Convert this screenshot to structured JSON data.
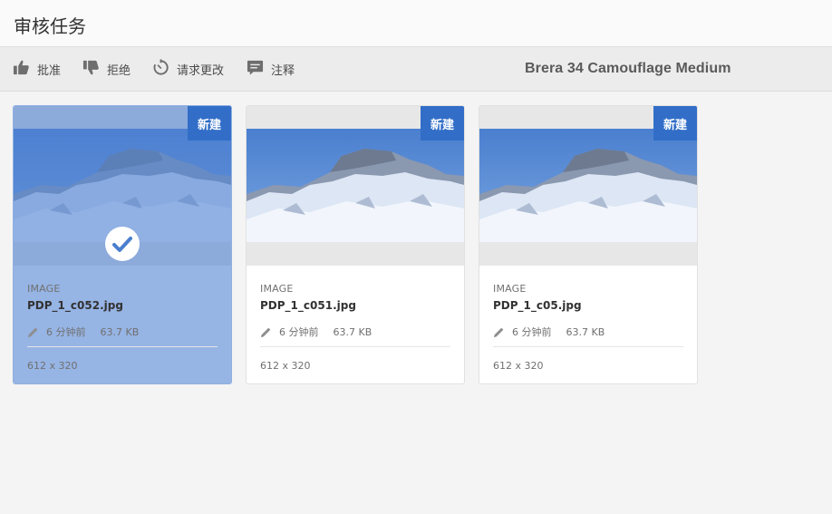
{
  "header": {
    "title": "审核任务"
  },
  "toolbar": {
    "approve_label": "批准",
    "reject_label": "拒绝",
    "request_changes_label": "请求更改",
    "comment_label": "注释",
    "asset_name": "Brera 34 Camouflage Medium"
  },
  "cards": [
    {
      "badge": "新建",
      "type": "IMAGE",
      "filename": "PDP_1_c052.jpg",
      "modified": "6 分钟前",
      "size": "63.7 KB",
      "dimensions": "612 x 320",
      "selected": true
    },
    {
      "badge": "新建",
      "type": "IMAGE",
      "filename": "PDP_1_c051.jpg",
      "modified": "6 分钟前",
      "size": "63.7 KB",
      "dimensions": "612 x 320",
      "selected": false
    },
    {
      "badge": "新建",
      "type": "IMAGE",
      "filename": "PDP_1_c05.jpg",
      "modified": "6 分钟前",
      "size": "63.7 KB",
      "dimensions": "612 x 320",
      "selected": false
    }
  ],
  "colors": {
    "accent": "#326ec8",
    "selection_overlay": "#5082d2"
  },
  "icons": [
    "thumbs-up-icon",
    "thumbs-down-icon",
    "timer-icon",
    "comment-icon",
    "pencil-icon",
    "checkmark-icon"
  ]
}
